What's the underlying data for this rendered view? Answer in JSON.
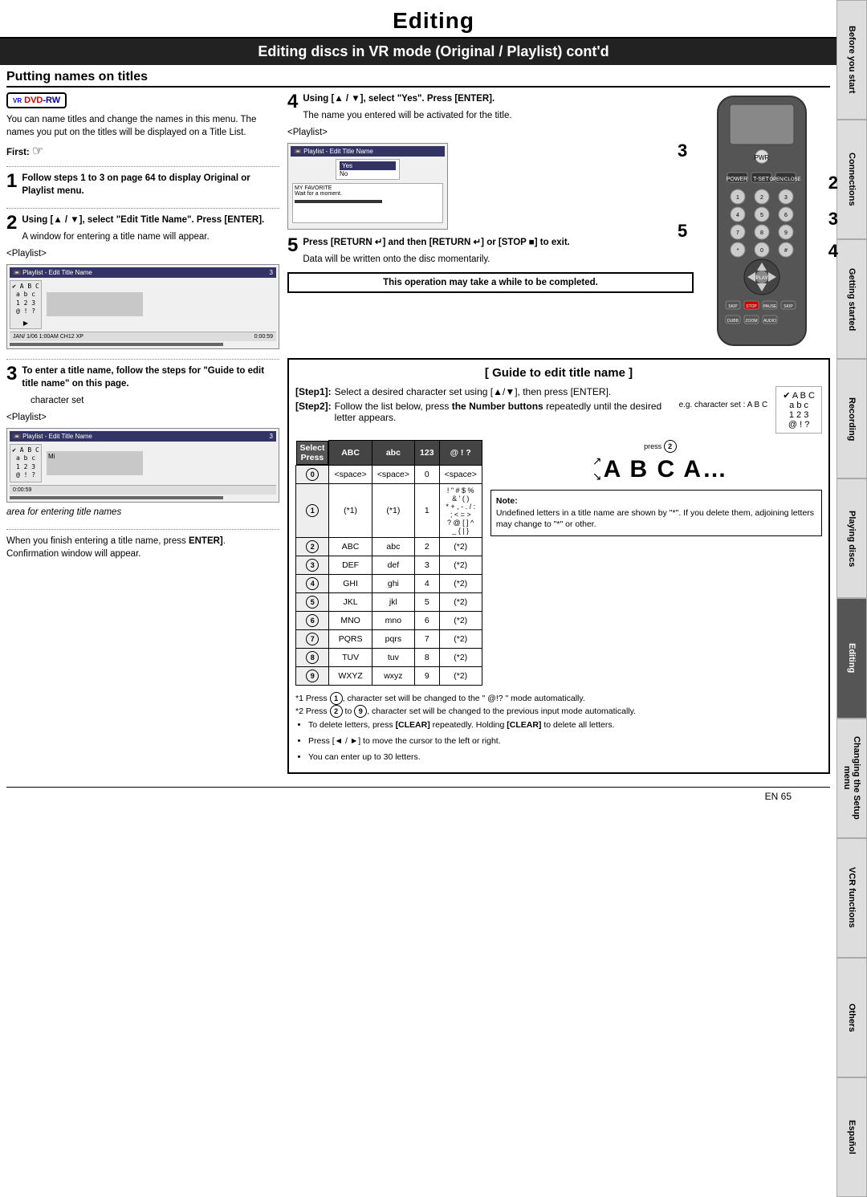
{
  "page": {
    "title": "Editing",
    "section_title": "Editing discs in VR mode (Original / Playlist) cont'd",
    "subsection_title": "Putting names on titles",
    "page_num": "EN  65"
  },
  "sidebar": {
    "tabs": [
      {
        "label": "Before you start",
        "active": false
      },
      {
        "label": "Connections",
        "active": false
      },
      {
        "label": "Getting started",
        "active": false
      },
      {
        "label": "Recording",
        "active": false
      },
      {
        "label": "Playing discs",
        "active": false
      },
      {
        "label": "Editing",
        "active": true
      },
      {
        "label": "Changing the Setup menu",
        "active": false
      },
      {
        "label": "VCR functions",
        "active": false
      },
      {
        "label": "Others",
        "active": false
      },
      {
        "label": "Español",
        "active": false
      }
    ]
  },
  "dvd_badge": {
    "vr": "VR",
    "dvd": "DVD",
    "rw": "-RW"
  },
  "intro_text": "You can name titles and change the names in this menu. The names you put on the titles will be displayed on a Title List.",
  "first_label": "First:",
  "step1": {
    "number": "1",
    "text": "Follow steps 1 to 3 on page 64 to display Original or Playlist menu."
  },
  "step2": {
    "number": "2",
    "instruction": "Using [▲ / ▼], select \"Edit Title Name\". Press [ENTER].",
    "desc": "A window for entering a title name will appear.",
    "playlist_label": "<Playlist>",
    "playlist_title": "Playlist - Edit Title Name",
    "abc_lines": [
      "✔ A B C",
      "a b c",
      "1 2 3",
      "@ ! ?"
    ],
    "bottom_text": "JAN/ 1/06 1:00AM CH12 XP",
    "time": "0:00:59"
  },
  "step3": {
    "number": "3",
    "text": "To enter a title name, follow the steps for \"Guide to edit title name\" on this page.",
    "char_set": "character set",
    "playlist_label": "<Playlist>",
    "playlist_title": "Playlist - Edit Title Name",
    "abc_lines": [
      "✔ A B C",
      "a b c",
      "1 2 3",
      "@ ! ?"
    ],
    "mi_text": "Mi",
    "time": "0:00:59",
    "area_text": "area for entering title names"
  },
  "finish_text": "When you finish entering a title name, press [ENTER]. Confirmation window will appear.",
  "step4": {
    "number": "4",
    "instruction": "Using [▲ / ▼], select \"Yes\". Press [ENTER].",
    "desc": "The name you entered will be activated for the title.",
    "playlist_label": "<Playlist>",
    "playlist_title": "Playlist - Edit Title Name",
    "yes_label": "Yes",
    "no_label": "No",
    "favorite_text": "MY FAVORITE",
    "wait_text": "Wait for a moment."
  },
  "step5_return": {
    "number": "5",
    "instruction": "Press [RETURN ↵] and then [RETURN ↵] or [STOP ■] to exit.",
    "desc": "Data will be written onto the disc momentarily."
  },
  "warning": {
    "text": "This operation may take a while to be completed."
  },
  "remote_numbers": {
    "n3": "3",
    "n5": "5",
    "n2": "2",
    "n3b": "3",
    "n4": "4"
  },
  "guide": {
    "title": "[ Guide to edit title name ]",
    "step1_label": "[Step1]:",
    "step1_text": "Select a desired character set using [▲/▼], then press [ENTER].",
    "step2_label": "[Step2]:",
    "step2_text": "Follow the list below, press the Number buttons repeatedly until the desired letter appears.",
    "eg_label": "e.g. character set : A B C",
    "select_label": "Select",
    "press_label": "Press",
    "abc_display": [
      "✔ A B C",
      "a b c",
      "1 2 3",
      "@ ! ?"
    ],
    "press2_label": "press ②",
    "abca_text": "A B C A…",
    "columns": [
      "ABC",
      "abc",
      "123",
      "@!?"
    ],
    "rows": [
      {
        "num": "0",
        "abc": "<space>",
        "abc_lower": "<space>",
        "n123": "0",
        "sym": "<space>"
      },
      {
        "num": "1",
        "abc": "(*1)",
        "abc_lower": "(*1)",
        "n123": "1",
        "sym": "! \" # $ % & ' ( )\n* + , - . / : ; < = >\n? @ [ ] ^ _ { | }"
      },
      {
        "num": "2",
        "abc": "ABC",
        "abc_lower": "abc",
        "n123": "2",
        "sym": "(*2)"
      },
      {
        "num": "3",
        "abc": "DEF",
        "abc_lower": "def",
        "n123": "3",
        "sym": "(*2)"
      },
      {
        "num": "4",
        "abc": "GHI",
        "abc_lower": "ghi",
        "n123": "4",
        "sym": "(*2)"
      },
      {
        "num": "5",
        "abc": "JKL",
        "abc_lower": "jkl",
        "n123": "5",
        "sym": "(*2)"
      },
      {
        "num": "6",
        "abc": "MNO",
        "abc_lower": "mno",
        "n123": "6",
        "sym": "(*2)"
      },
      {
        "num": "7",
        "abc": "PQRS",
        "abc_lower": "pqrs",
        "n123": "7",
        "sym": "(*2)"
      },
      {
        "num": "8",
        "abc": "TUV",
        "abc_lower": "tuv",
        "n123": "8",
        "sym": "(*2)"
      },
      {
        "num": "9",
        "abc": "WXYZ",
        "abc_lower": "wxyz",
        "n123": "9",
        "sym": "(*2)"
      }
    ]
  },
  "note": {
    "title": "Note:",
    "lines": [
      "Undefined letters in a title name are shown by \"*\". If you delete them, adjoining letters may change to \"*\" or other."
    ]
  },
  "footnotes": [
    "*1 Press ①, character set will be changed to the \" @!? \" mode automatically.",
    "*2 Press ② to ⑨, character set will be changed to the previous input mode automatically.",
    "• To delete letters, press [CLEAR] repeatedly. Holding [CLEAR] to delete all letters.",
    "• Press [◄ / ►] to move the cursor to the left or right.",
    "• You can enter up to 30 letters."
  ]
}
